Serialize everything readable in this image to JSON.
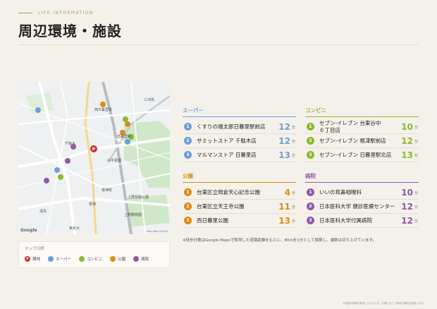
{
  "header": {
    "eyebrow": "LIFE INFORMATION",
    "title": "周辺環境・施設"
  },
  "map": {
    "labels": [
      "西日暮里駅",
      "日暮里駅",
      "千駄木",
      "谷中霊園",
      "根津",
      "東京大",
      "上野動物園",
      "三河島",
      "根津駅",
      "湯島",
      "上野恩賜公園"
    ],
    "google_text": "Google",
    "credit": "Map data ©2025"
  },
  "legend": {
    "title": "マップ凡例",
    "items": [
      {
        "label": "現地",
        "color": "#c8312f",
        "glyph": "P"
      },
      {
        "label": "スーパー",
        "color": "#6f9ed6",
        "glyph": ""
      },
      {
        "label": "コンビニ",
        "color": "#8db92e",
        "glyph": ""
      },
      {
        "label": "公園",
        "color": "#e08a13",
        "glyph": ""
      },
      {
        "label": "病院",
        "color": "#8b5ba8",
        "glyph": ""
      }
    ]
  },
  "colors": {
    "super": "#6f9ed6",
    "conv": "#8db92e",
    "park": "#e08a13",
    "hospital": "#8b5ba8",
    "site": "#c8312f"
  },
  "categories": {
    "super": {
      "title": "スーパー",
      "items": [
        {
          "num": "1",
          "name": "くすりの福太郎日暮里駅前店",
          "minutes": "12",
          "unit": "分"
        },
        {
          "num": "2",
          "name": "サミットストア 千駄木店",
          "minutes": "12",
          "unit": "分"
        },
        {
          "num": "3",
          "name": "マルマンストア 日暮里店",
          "minutes": "13",
          "unit": "分"
        }
      ]
    },
    "conv": {
      "title": "コンビニ",
      "items": [
        {
          "num": "1",
          "name": "セブン-イレブン 台東谷中\n６丁目店",
          "minutes": "10",
          "unit": "分"
        },
        {
          "num": "2",
          "name": "セブン-イレブン 根津駅前店",
          "minutes": "12",
          "unit": "分"
        },
        {
          "num": "3",
          "name": "セブン-イレブン 日暮里駅北店",
          "minutes": "13",
          "unit": "分"
        }
      ]
    },
    "park": {
      "title": "公園",
      "items": [
        {
          "num": "1",
          "name": "台東区立岡倉天心記念公園",
          "minutes": "4",
          "unit": "分"
        },
        {
          "num": "2",
          "name": "台東区立天王寺公園",
          "minutes": "11",
          "unit": "分"
        },
        {
          "num": "3",
          "name": "西日暮里公園",
          "minutes": "13",
          "unit": "分"
        }
      ]
    },
    "hospital": {
      "title": "病院",
      "items": [
        {
          "num": "1",
          "name": "いいの耳鼻咽喉科",
          "minutes": "10",
          "unit": "分"
        },
        {
          "num": "2",
          "name": "日本医科大学 健診医療センター",
          "minutes": "12",
          "unit": "分"
        },
        {
          "num": "3",
          "name": "日本医科大学付属病院",
          "minutes": "12",
          "unit": "分"
        }
      ]
    }
  },
  "note": "※徒歩分数はGoogle Mapsで取得した道路距離をもとに、80mを1分として換算し、端数は切り上げています。",
  "footnote": "※地図は情報を整理したものです。必要に応じて現地の確認を推奨します。"
}
